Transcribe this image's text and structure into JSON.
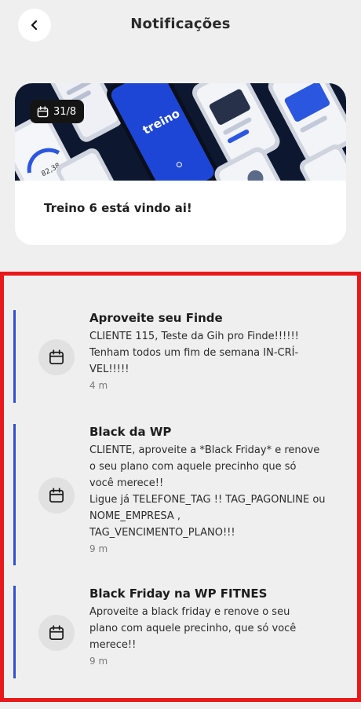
{
  "header": {
    "title": "Notificações",
    "back_icon": "chevron-left-icon"
  },
  "banner": {
    "badge_icon": "calendar-icon",
    "badge_date": "31/8",
    "phone_brand": "treino",
    "title": "Treino 6 está vindo ai!"
  },
  "notifications": [
    {
      "icon": "calendar-icon",
      "title": "Aproveite seu Finde",
      "body": "CLIENTE 115, Teste da Gih pro Finde!!!!!!\nTenham todos um fim de semana IN-CRÍ-\nVEL!!!!!",
      "time": "4 m"
    },
    {
      "icon": "calendar-icon",
      "title": "Black da WP",
      "body": "CLIENTE, aproveite a *Black Friday* e renove\no seu plano com aquele precinho que só\nvocê merece!!\nLigue já TELEFONE_TAG !! TAG_PAGONLINE ou\nNOME_EMPRESA ,\nTAG_VENCIMENTO_PLANO!!!",
      "time": "9 m"
    },
    {
      "icon": "calendar-icon",
      "title": "Black Friday na WP FITNES",
      "body": "Aproveite a black friday e renove o seu\nplano com aquele precinho, que só você\nmerece!!",
      "time": "9 m"
    }
  ],
  "colors": {
    "accent_line": "#2f4fd3",
    "highlight_border": "#e8191a",
    "background": "#efefef"
  }
}
